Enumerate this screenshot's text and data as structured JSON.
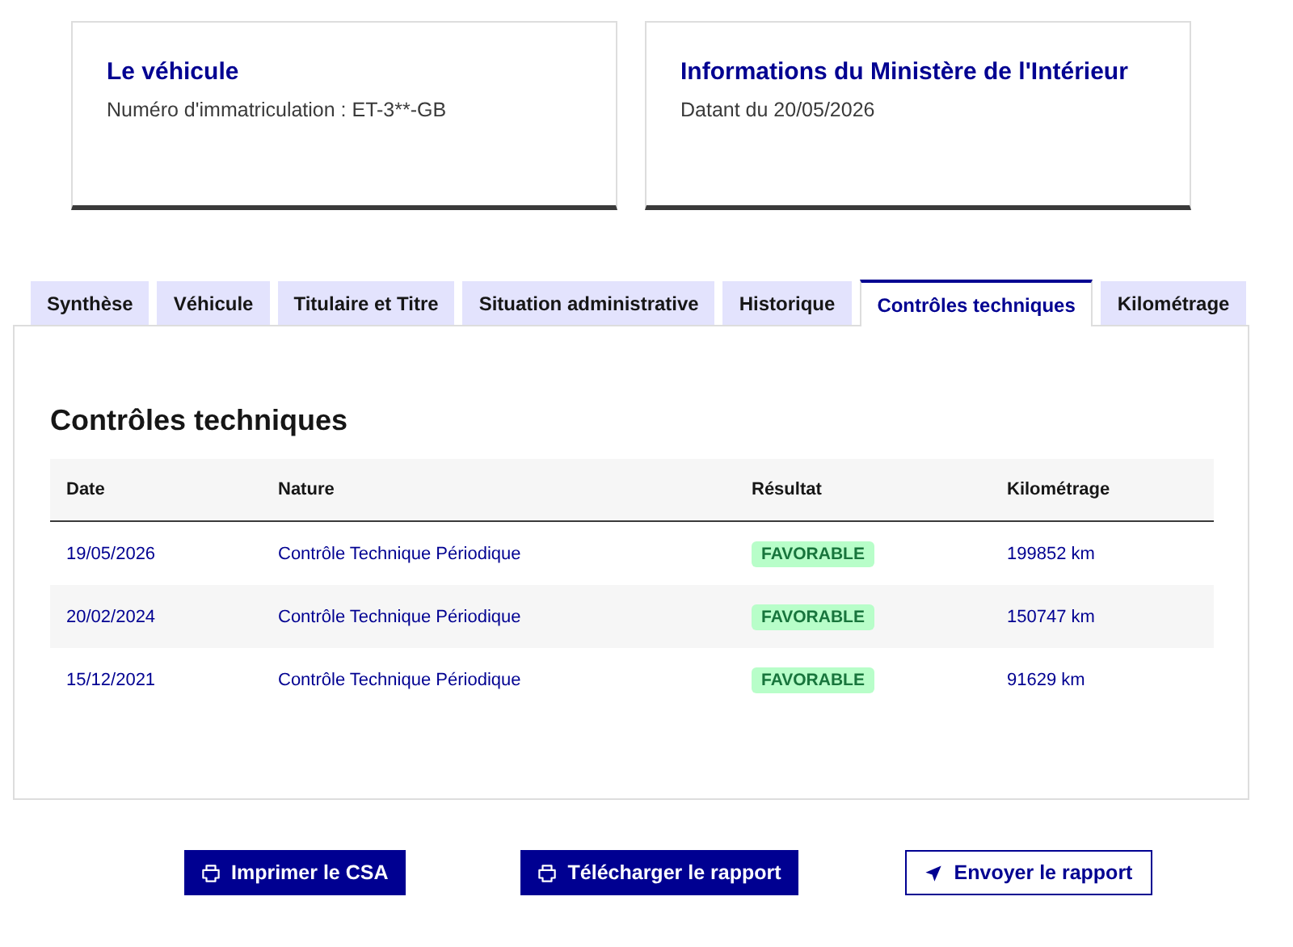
{
  "cards": [
    {
      "title": "Le véhicule",
      "text": "Numéro d'immatriculation : ET-3**-GB"
    },
    {
      "title": "Informations du Ministère de l'Intérieur",
      "text": "Datant du 20/05/2026"
    }
  ],
  "tabs": [
    {
      "label": "Synthèse",
      "selected": false
    },
    {
      "label": "Véhicule",
      "selected": false
    },
    {
      "label": "Titulaire et Titre",
      "selected": false
    },
    {
      "label": "Situation administrative",
      "selected": false
    },
    {
      "label": "Historique",
      "selected": false
    },
    {
      "label": "Contrôles techniques",
      "selected": true
    },
    {
      "label": "Kilométrage",
      "selected": false
    }
  ],
  "section": {
    "title": "Contrôles techniques"
  },
  "table": {
    "columns": [
      "Date",
      "Nature",
      "Résultat",
      "Kilométrage"
    ],
    "rows": [
      {
        "date": "19/05/2026",
        "nature": "Contrôle Technique Périodique",
        "result": "FAVORABLE",
        "mileage": "199852 km"
      },
      {
        "date": "20/02/2024",
        "nature": "Contrôle Technique Périodique",
        "result": "FAVORABLE",
        "mileage": "150747 km"
      },
      {
        "date": "15/12/2021",
        "nature": "Contrôle Technique Périodique",
        "result": "FAVORABLE",
        "mileage": "91629 km"
      }
    ]
  },
  "buttons": [
    {
      "label": "Imprimer le CSA",
      "kind": "primary"
    },
    {
      "label": "Télécharger le rapport",
      "kind": "primary"
    },
    {
      "label": "Envoyer le rapport",
      "kind": "secondary"
    }
  ]
}
